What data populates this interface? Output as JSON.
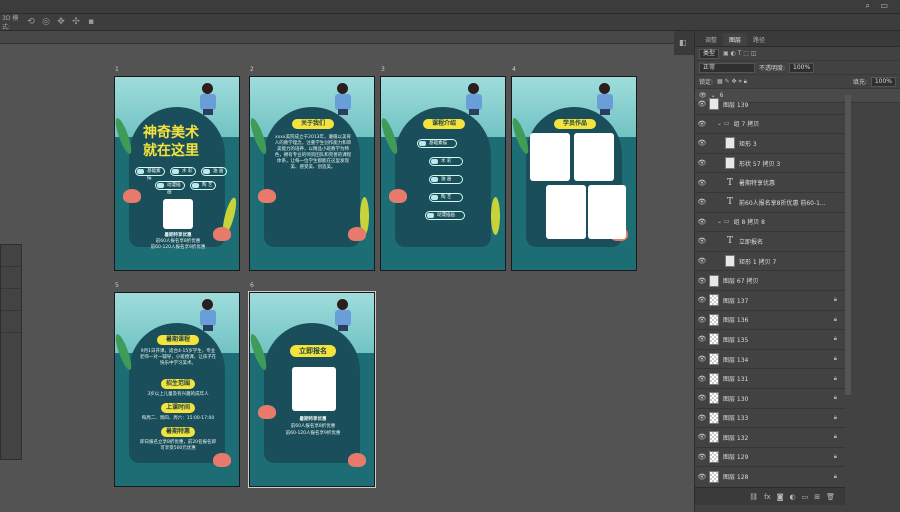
{
  "options_bar": {
    "mode_label": "3D 模式:"
  },
  "artboards": [
    {
      "label": "1",
      "title_line1": "神奇美术",
      "title_line2": "就在这里",
      "buttons": [
        "基础素描",
        "水 彩",
        "油 画",
        "陶 艺",
        "动漫插画"
      ],
      "footer_title": "暑期特享优惠",
      "footer_line1": "前60人报名享8折优惠",
      "footer_line2": "前60-120人报名享9折优惠"
    },
    {
      "label": "2",
      "pill": "关于我们",
      "body": "xxxx美院成立于2013年，遵循以美育人的教学理念，注重学生创作能力和审美能力的培养，以精品小班教学为特色，拥有专业的师资团队和完善的课程体系，让每一位学生都能在这里发现美、感受美、创造美。"
    },
    {
      "label": "3",
      "pill": "课程介绍",
      "buttons": [
        "基础素描",
        "水 彩",
        "油 画",
        "陶 艺",
        "动漫插画"
      ]
    },
    {
      "label": "4",
      "pill": "学员作品"
    },
    {
      "label": "5",
      "pill": "暑期课程",
      "body": "9月1日开课，适合4-15岁学生，专业老师一对一辅导，小班授课，让孩子在快乐中学习美术。",
      "sub1": "招生范围",
      "sub1_text": "3岁以上儿童及有兴趣的成年人",
      "sub2": "上课时间",
      "sub2_text": "每周二、周四、周六：15:00-17:00",
      "sub3": "暑期特惠",
      "sub3_text": "即日报名立享8折优惠，前20名报名即可享受500元优惠"
    },
    {
      "label": "6",
      "pill": "立即报名",
      "footer_title": "暑期特享优惠",
      "footer_line1": "前60人报名享8折优惠",
      "footer_line2": "前60-120人报名享9折优惠"
    }
  ],
  "panel": {
    "tabs": [
      "调整",
      "图层",
      "路径"
    ],
    "kind_label": "类型",
    "blend_mode": "正常",
    "opacity_label": "不透明度:",
    "opacity_value": "100%",
    "lock_label": "锁定:",
    "fill_label": "填充:",
    "fill_value": "100%",
    "group_label": "6",
    "layers": [
      {
        "name": "图层 139",
        "type": "img",
        "indent": 0
      },
      {
        "name": "组 7 拷贝",
        "type": "folder",
        "indent": 1
      },
      {
        "name": "矩形 3",
        "type": "img",
        "indent": 2
      },
      {
        "name": "形状 57 拷贝 3",
        "type": "img",
        "indent": 2
      },
      {
        "name": "暑期特享优惠",
        "type": "text",
        "indent": 2
      },
      {
        "name": "前60人报名享8折优惠 前60-1...",
        "type": "text",
        "indent": 2
      },
      {
        "name": "组 8 拷贝 8",
        "type": "folder",
        "indent": 1
      },
      {
        "name": "立即报名",
        "type": "text",
        "indent": 2
      },
      {
        "name": "矩形 1 拷贝 7",
        "type": "img",
        "indent": 2
      },
      {
        "name": "图层 67 拷贝",
        "type": "img",
        "indent": 0
      },
      {
        "name": "图层 137",
        "type": "check",
        "indent": 0,
        "locked": true
      },
      {
        "name": "图层 136",
        "type": "check",
        "indent": 0,
        "locked": true
      },
      {
        "name": "图层 135",
        "type": "check",
        "indent": 0,
        "locked": true
      },
      {
        "name": "图层 134",
        "type": "check",
        "indent": 0,
        "locked": true
      },
      {
        "name": "图层 131",
        "type": "check",
        "indent": 0,
        "locked": true
      },
      {
        "name": "图层 130",
        "type": "check",
        "indent": 0,
        "locked": true
      },
      {
        "name": "图层 133",
        "type": "check",
        "indent": 0,
        "locked": true
      },
      {
        "name": "图层 132",
        "type": "check",
        "indent": 0,
        "locked": true
      },
      {
        "name": "图层 129",
        "type": "check",
        "indent": 0,
        "locked": true
      },
      {
        "name": "图层 128",
        "type": "check",
        "indent": 0,
        "locked": true
      }
    ]
  }
}
